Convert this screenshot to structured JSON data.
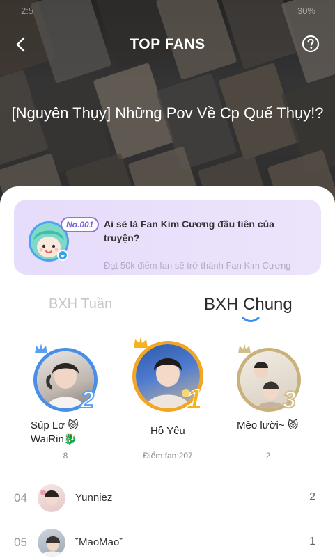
{
  "status": {
    "time": "2:5",
    "battery": "30%"
  },
  "header": {
    "title": "TOP FANS"
  },
  "story": {
    "title": "[Nguyên Thụy] Những Pov Về Cp Quế Thụy!?"
  },
  "promo": {
    "badge": "No.001",
    "headline": "Ai sẽ là Fan Kim Cương đầu tiên của truyện?",
    "sub": "Đạt 50k điểm fan sẽ trở thành Fan Kim Cương"
  },
  "tabs": {
    "week": "BXH Tuần",
    "all": "BXH Chung",
    "active": "all"
  },
  "podium": [
    {
      "rank": "2",
      "name": "Súp Lơ 😾 WaiRin🐉",
      "points": "8",
      "ring_color": "#4a8fe7",
      "rank_color": "#5aa0f0"
    },
    {
      "rank": "1",
      "name": "Hồ Yêu",
      "points": "Điểm fan:207",
      "ring_color": "#f2a623",
      "rank_color": "#f6b21e"
    },
    {
      "rank": "3",
      "name": "Mèo lười~ 😾",
      "points": "2",
      "ring_color": "#c9b27a",
      "rank_color": "#d2bd86"
    }
  ],
  "list": [
    {
      "rank": "04",
      "name": "Yunniez",
      "score": "2"
    },
    {
      "rank": "05",
      "name": "˘MaoMao˘",
      "score": "1"
    }
  ],
  "icons": {
    "back": "chevron-left-icon",
    "help": "question-circle-icon",
    "crown": "crown-icon"
  }
}
